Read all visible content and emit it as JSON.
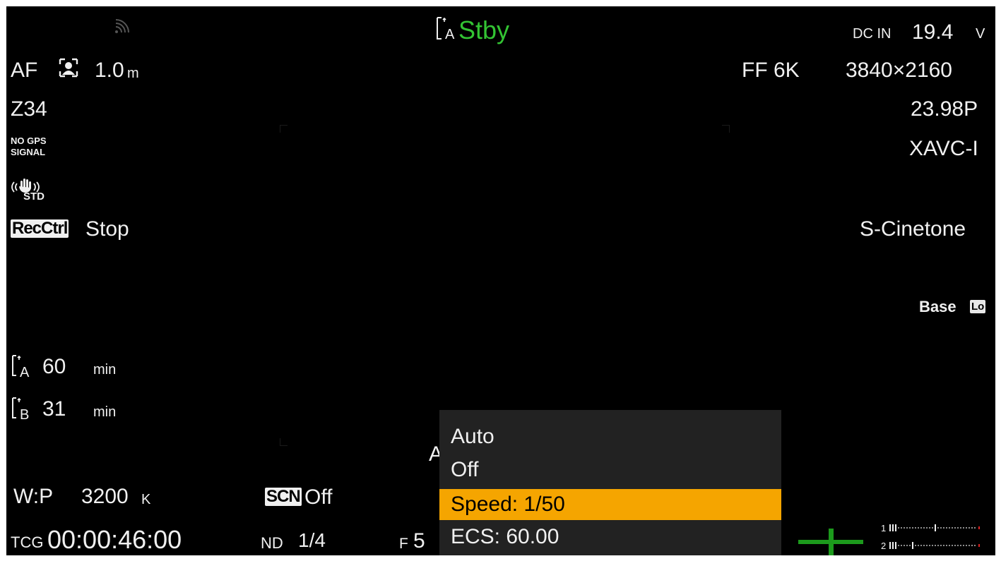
{
  "top": {
    "slot_label": "A",
    "status": "Stby",
    "power_prefix": "DC IN",
    "power_value": "19.4",
    "power_unit": "V"
  },
  "left": {
    "af_label": "AF",
    "focus_distance": "1.0",
    "focus_unit": "m",
    "zoom": "Z34",
    "gps_line1": "NO GPS",
    "gps_line2": "SIGNAL",
    "stab_mode": "STD",
    "rec_ctrl_badge": "RecCtrl",
    "rec_ctrl_state": "Stop",
    "slots": [
      {
        "slot": "A",
        "value": "60",
        "unit": "min"
      },
      {
        "slot": "B",
        "value": "31",
        "unit": "min"
      }
    ],
    "white_balance_label": "W:P",
    "white_balance_value": "3200",
    "white_balance_unit": "K",
    "timecode_prefix": "TCG",
    "timecode": "00:00:46:00"
  },
  "right": {
    "sensor_mode": "FF 6K",
    "resolution": "3840×2160",
    "frame_rate": "23.98P",
    "codec": "XAVC-I",
    "look": "S-Cinetone",
    "base_label": "Base",
    "base_badge": "Lo"
  },
  "bottom": {
    "scn_badge": "SCN",
    "scn_value": "Off",
    "nd_label": "ND",
    "nd_value": "1/4",
    "iris_prefix": "F",
    "iris_value": "5",
    "partial_glyph": "A",
    "audio_ch1": "1",
    "audio_ch2": "2"
  },
  "shutter_menu": {
    "items": [
      "Auto",
      "Off",
      "Speed: 1/50",
      "ECS: 60.00"
    ],
    "selected_index": 2
  },
  "colors": {
    "status_green": "#33c433",
    "selection": "#f5a500",
    "menu_bg": "#222222"
  }
}
